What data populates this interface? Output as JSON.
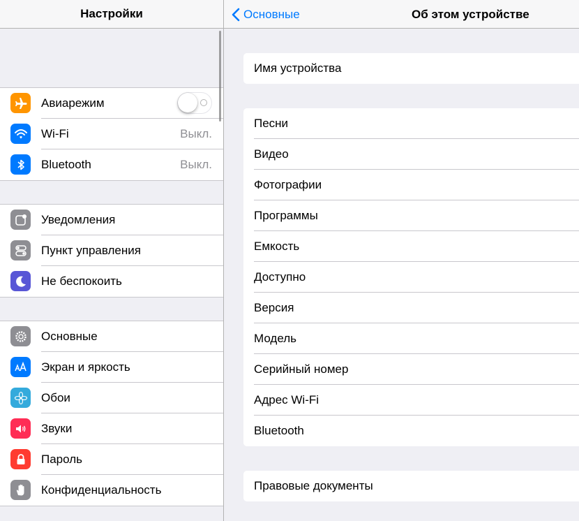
{
  "left_pane": {
    "title": "Настройки",
    "groups": [
      [
        {
          "label": "Авиарежим",
          "icon": "airplane-icon",
          "icon_color": "#ff9500",
          "toggle": "off"
        },
        {
          "label": "Wi-Fi",
          "icon": "wifi-icon",
          "icon_color": "#007aff",
          "value": "Выкл."
        },
        {
          "label": "Bluetooth",
          "icon": "bluetooth-icon",
          "icon_color": "#007aff",
          "value": "Выкл."
        }
      ],
      [
        {
          "label": "Уведомления",
          "icon": "notifications-icon",
          "icon_color": "#8e8e93"
        },
        {
          "label": "Пункт управления",
          "icon": "control-center-icon",
          "icon_color": "#8e8e93"
        },
        {
          "label": "Не беспокоить",
          "icon": "moon-icon",
          "icon_color": "#5856d6"
        }
      ],
      [
        {
          "label": "Основные",
          "icon": "gear-icon",
          "icon_color": "#8e8e93"
        },
        {
          "label": "Экран и яркость",
          "icon": "display-brightness-icon",
          "icon_color": "#007aff"
        },
        {
          "label": "Обои",
          "icon": "wallpaper-flower-icon",
          "icon_color": "#34aadc"
        },
        {
          "label": "Звуки",
          "icon": "speaker-icon",
          "icon_color": "#ff2d55"
        },
        {
          "label": "Пароль",
          "icon": "lock-icon",
          "icon_color": "#ff3b30"
        },
        {
          "label": "Конфиденциальность",
          "icon": "hand-icon",
          "icon_color": "#8e8e93"
        }
      ]
    ]
  },
  "right_pane": {
    "back_label": "Основные",
    "title": "Об этом устройстве",
    "groups": [
      [
        "Имя устройства"
      ],
      [
        "Песни",
        "Видео",
        "Фотографии",
        "Программы",
        "Емкость",
        "Доступно",
        "Версия",
        "Модель",
        "Серийный номер",
        "Адрес Wi-Fi",
        "Bluetooth"
      ],
      [
        "Правовые документы"
      ]
    ]
  },
  "colors": {
    "accent": "#007aff",
    "background": "#efeff4",
    "separator": "#c8c7cc",
    "secondary_text": "#8e8e93"
  }
}
